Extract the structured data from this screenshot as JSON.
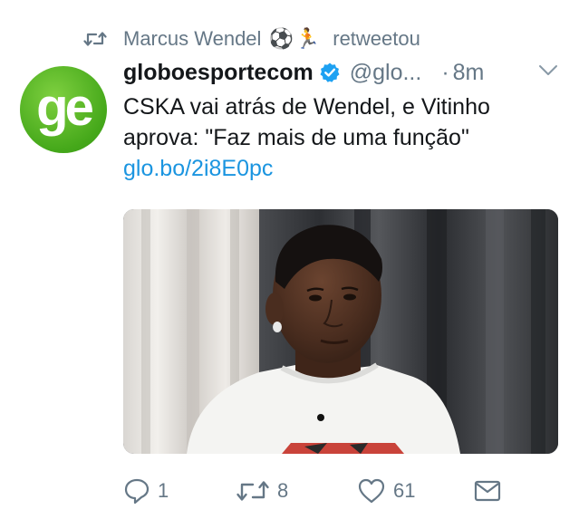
{
  "retweet": {
    "name": "Marcus Wendel",
    "emojis": [
      "⚽",
      "🏃"
    ],
    "verb": "retweetou"
  },
  "tweet": {
    "avatar_text": "ge",
    "display_name": "globoesportecom",
    "handle": "@glo...",
    "separator": "·",
    "time": "8m",
    "text_line1": "CSKA vai atrás de Wendel, e Vitinho",
    "text_line2": "aprova: \"Faz mais de uma função\"",
    "link": "glo.bo/2i8E0pc"
  },
  "actions": {
    "reply_count": "1",
    "retweet_count": "8",
    "like_count": "61"
  },
  "colors": {
    "link": "#1b95e0",
    "muted": "#657786",
    "verified": "#1da1f2",
    "brand_green": "#45a81a"
  }
}
